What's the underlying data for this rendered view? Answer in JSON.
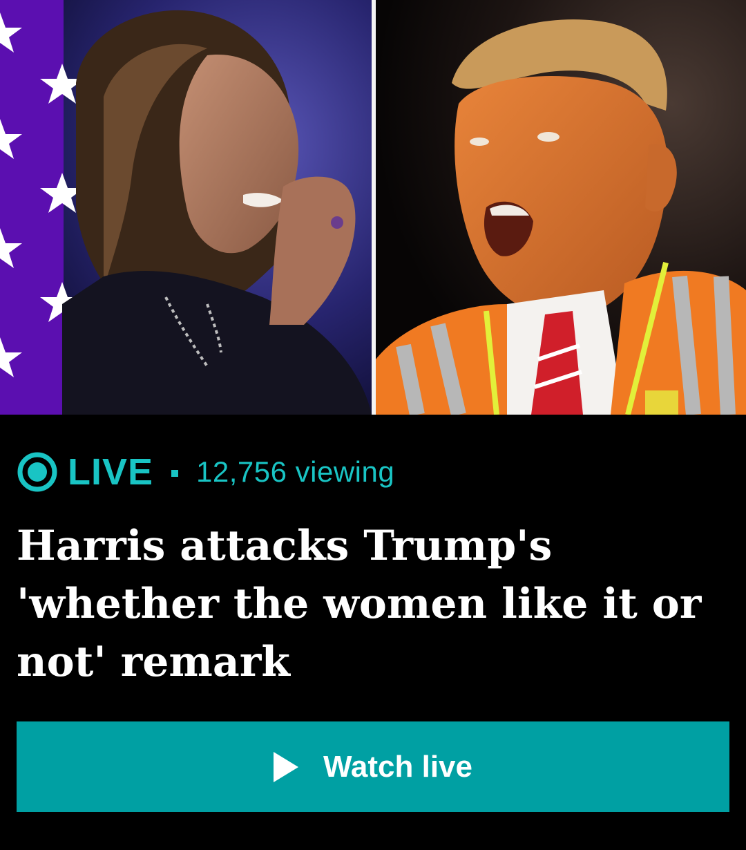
{
  "hero": {
    "left_photo": "Kamala Harris speaking at rally, purple backdrop with white stars",
    "right_photo": "Donald Trump shouting, wearing orange hi-vis safety vest"
  },
  "live": {
    "label": "LIVE",
    "viewers": "12,756 viewing",
    "icon": "live-broadcast-icon"
  },
  "headline": "Harris attacks Trump's 'whether the women like it or not' remark",
  "button": {
    "label": "Watch live",
    "icon": "play-icon"
  },
  "colors": {
    "accent": "#19c4c4",
    "button_bg": "#00a0a3",
    "background": "#000000",
    "text": "#ffffff"
  }
}
